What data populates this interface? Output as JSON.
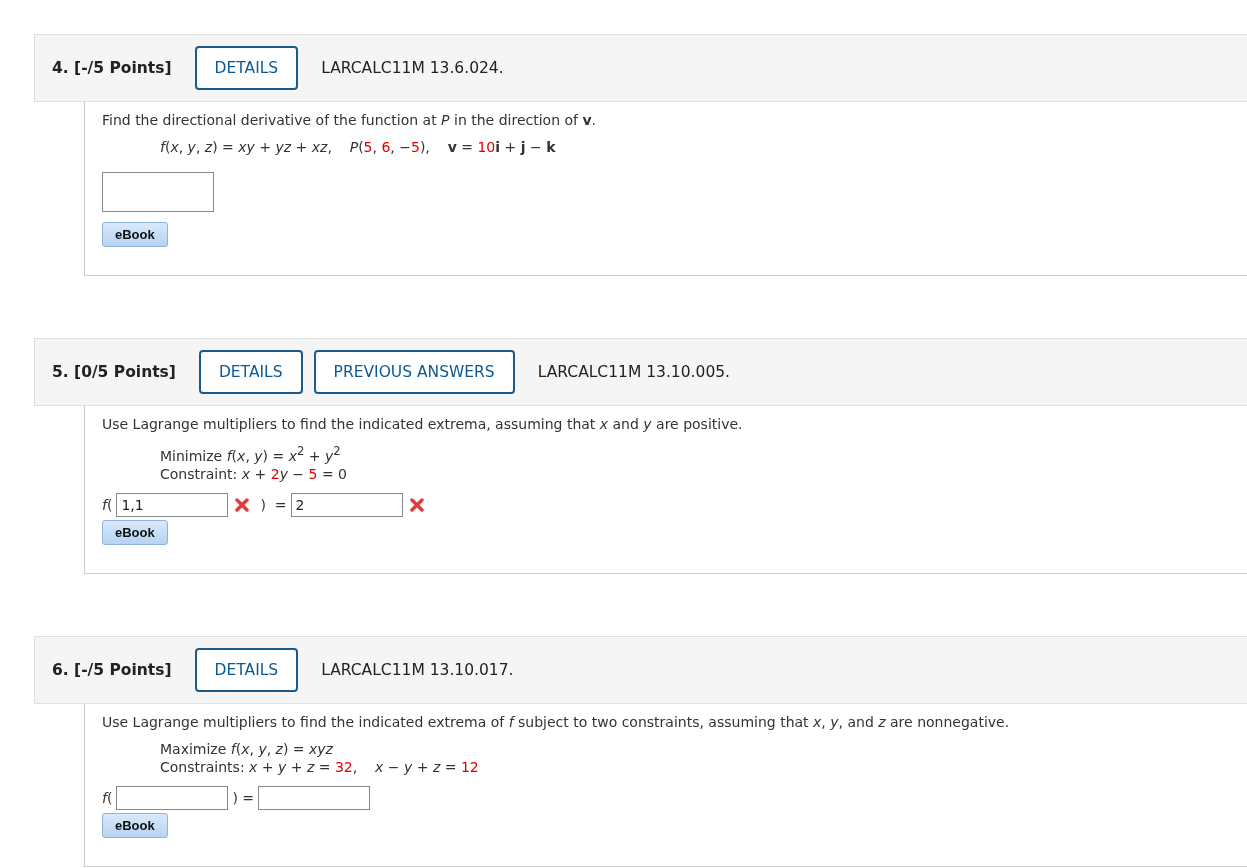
{
  "questions": [
    {
      "number": "4.",
      "points": "[-/5 Points]",
      "buttons": [
        "DETAILS"
      ],
      "code": "LARCALC11M 13.6.024.",
      "prompt": "Find the directional derivative of the function at *P* in the direction of **v**.",
      "math": [
        [
          {
            "text": "*f*(*x*, *y*, *z*) = *xy* + *yz* + *xz*,    *P*(",
            "highlight": false
          },
          {
            "text": "5",
            "highlight": true
          },
          {
            "text": ", ",
            "highlight": false
          },
          {
            "text": "6",
            "highlight": true
          },
          {
            "text": ", −",
            "highlight": false
          },
          {
            "text": "5",
            "highlight": true
          },
          {
            "text": "),    **v** = ",
            "highlight": false
          },
          {
            "text": "10",
            "highlight": true
          },
          {
            "text": "**i** + **j** − **k**",
            "highlight": false
          }
        ]
      ],
      "answer": [
        {
          "kind": "box",
          "incorrect": false
        }
      ],
      "ebook": "eBook"
    },
    {
      "number": "5.",
      "points": "[0/5 Points]",
      "buttons": [
        "DETAILS",
        "PREVIOUS ANSWERS"
      ],
      "code": "LARCALC11M 13.10.005.",
      "prompt": "Use Lagrange multipliers to find the indicated extrema, assuming that *x* and *y* are positive.",
      "math": [
        [
          {
            "text": "Minimize *f*(*x*, *y*) = *x*$^{2}$ + *y*$^{2}$",
            "highlight": false
          }
        ],
        [
          {
            "text": "Constraint: *x* + ",
            "highlight": false
          },
          {
            "text": "2",
            "highlight": true
          },
          {
            "text": "*y* − ",
            "highlight": false
          },
          {
            "text": "5",
            "highlight": true
          },
          {
            "text": " = 0",
            "highlight": false
          }
        ]
      ],
      "answer": [
        {
          "kind": "text",
          "text": "*f*("
        },
        {
          "kind": "field",
          "value": "1,1",
          "incorrect": true
        },
        {
          "kind": "text",
          "text": ")  ="
        },
        {
          "kind": "field",
          "value": "2",
          "incorrect": true
        }
      ],
      "ebook": "eBook"
    },
    {
      "number": "6.",
      "points": "[-/5 Points]",
      "buttons": [
        "DETAILS"
      ],
      "code": "LARCALC11M 13.10.017.",
      "prompt": "Use Lagrange multipliers to find the indicated extrema of *f* subject to two constraints, assuming that *x*, *y*, and *z* are nonnegative.",
      "math": [
        [
          {
            "text": "Maximize *f*(*x*, *y*, *z*) = *xyz*",
            "highlight": false
          }
        ],
        [
          {
            "text": "Constraints: *x* + *y* + *z* = ",
            "highlight": false
          },
          {
            "text": "32",
            "highlight": true
          },
          {
            "text": ",    *x* − *y* + *z* = ",
            "highlight": false
          },
          {
            "text": "12",
            "highlight": true
          }
        ]
      ],
      "answer": [
        {
          "kind": "text",
          "text": "*f*("
        },
        {
          "kind": "field",
          "incorrect": false
        },
        {
          "kind": "text",
          "text": ") ="
        },
        {
          "kind": "field",
          "incorrect": false
        }
      ],
      "ebook": "eBook"
    }
  ]
}
